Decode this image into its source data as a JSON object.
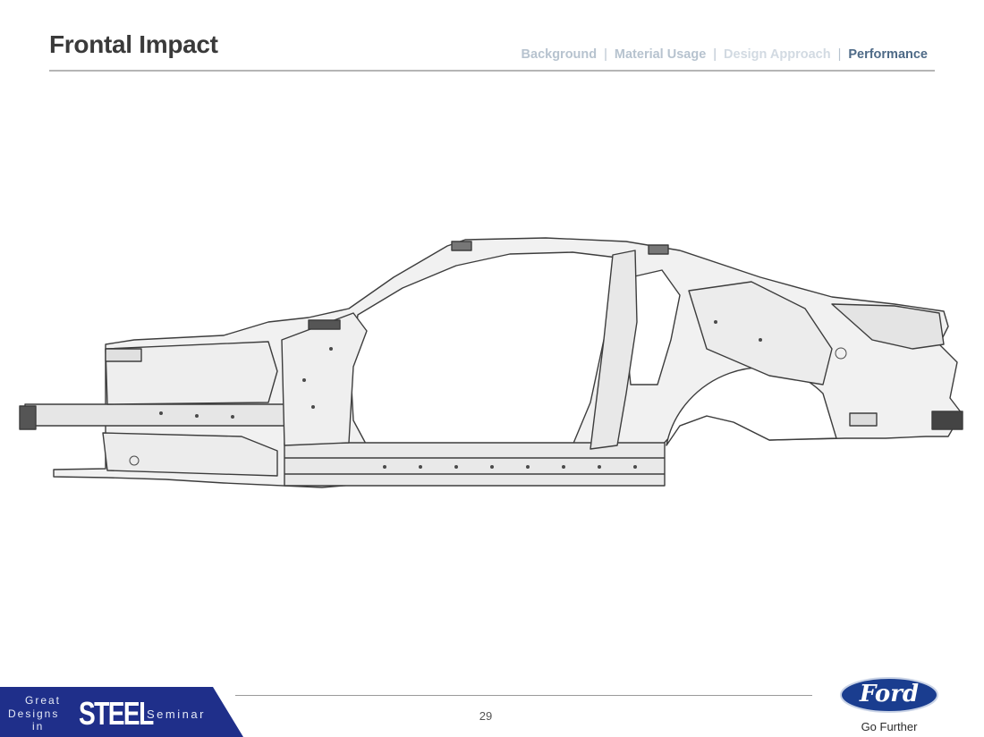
{
  "slide": {
    "title": "Frontal Impact",
    "page_number": "29"
  },
  "nav": {
    "items": [
      {
        "label": "Background",
        "state": "inactive"
      },
      {
        "label": "Material Usage",
        "state": "inactive"
      },
      {
        "label": "Design Approach",
        "state": "dim"
      },
      {
        "label": "Performance",
        "state": "active"
      }
    ],
    "separator": "|"
  },
  "footer": {
    "brand": {
      "line1": "Great",
      "line2": "Designs",
      "line3": "in",
      "steel": "STEEL",
      "seminar": "Seminar"
    },
    "logo": {
      "wordmark": "Ford",
      "tagline": "Go Further"
    }
  },
  "colors": {
    "title": "#3a3a3a",
    "nav_active": "#4e6a87",
    "nav_inactive": "#b7c3cf",
    "brand_band": "#1f2f8a",
    "ford_oval": "#1a3d8f"
  }
}
